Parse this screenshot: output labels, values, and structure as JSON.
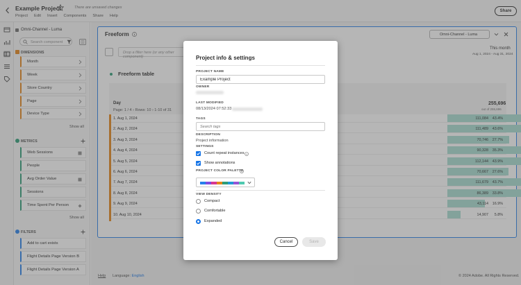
{
  "header": {
    "project_title": "Example Project",
    "unsaved_text": "There are unsaved changes",
    "menu": [
      "Project",
      "Edit",
      "Insert",
      "Components",
      "Share",
      "Help"
    ],
    "share_label": "Share"
  },
  "left_panel": {
    "report_suite": "Omni-Channel - Luma",
    "search_placeholder": "Search component",
    "dimensions_header": "DIMENSIONS",
    "dimensions": [
      "Month",
      "Week",
      "Store Country",
      "Page",
      "Device Type"
    ],
    "metrics_header": "METRICS",
    "metrics": [
      "Web Sessions",
      "People",
      "Avg Order Value",
      "Sessions",
      "Time Spent Per Person"
    ],
    "filters_header": "FILTERS",
    "filters": [
      "Add to cart exists",
      "Flight Details Page Version B",
      "Flight Details Page Version A"
    ],
    "show_all": "Show all"
  },
  "freeform": {
    "title": "Freeform",
    "suite_select": "Omni-Channel - Luma",
    "drop_filter_placeholder": "Drop a filter here (or any other component)",
    "date_label": "This month",
    "date_range": "Aug 1, 2024 - Aug 31, 2024",
    "table_title": "Freeform table",
    "day_header": "Day",
    "page_info": "Page: 1 / 4 › Rows: 10 › 1-10 of 31",
    "total_value": "255,696",
    "total_sub": "out of 255,696",
    "rows": [
      {
        "label": "1.  Aug 1, 2024",
        "value": "111,084",
        "pct": "43.4%",
        "share": 0.434
      },
      {
        "label": "2.  Aug 2, 2024",
        "value": "111,489",
        "pct": "43.6%",
        "share": 0.436
      },
      {
        "label": "3.  Aug 3, 2024",
        "value": "70,746",
        "pct": "27.7%",
        "share": 0.277
      },
      {
        "label": "4.  Aug 4, 2024",
        "value": "90,328",
        "pct": "35.3%",
        "share": 0.353
      },
      {
        "label": "5.  Aug 5, 2024",
        "value": "112,144",
        "pct": "43.9%",
        "share": 0.439
      },
      {
        "label": "6.  Aug 6, 2024",
        "value": "70,667",
        "pct": "27.6%",
        "share": 0.276
      },
      {
        "label": "7.  Aug 7, 2024",
        "value": "111,679",
        "pct": "43.7%",
        "share": 0.437
      },
      {
        "label": "8.  Aug 8, 2024",
        "value": "86,389",
        "pct": "33.8%",
        "share": 0.338
      },
      {
        "label": "9.  Aug 9, 2024",
        "value": "43,114",
        "pct": "16.9%",
        "share": 0.169
      },
      {
        "label": "10. Aug 10, 2024",
        "value": "14,907",
        "pct": "5.8%",
        "share": 0.058
      }
    ]
  },
  "footer": {
    "help": "Help",
    "language_label": "Language:",
    "language_value": "English",
    "copyright": "© 2024 Adobe. All Rights Reserved."
  },
  "modal": {
    "title": "Project info & settings",
    "project_name_label": "PROJECT NAME",
    "project_name_value": "Example Project",
    "owner_label": "OWNER",
    "last_modified_label": "LAST MODIFIED",
    "last_modified_value": "08/13/2024 07:52:33",
    "tags_label": "TAGS",
    "tags_placeholder": "Search tags",
    "description_label": "DESCRIPTION",
    "description_value": "Project information",
    "settings_label": "SETTINGS",
    "count_repeat_label": "Count repeat instances",
    "count_repeat_checked": true,
    "show_annotations_label": "Show annotations",
    "show_annotations_checked": true,
    "palette_label": "PROJECT COLOR PALETTE",
    "palette_colors": [
      "#2680eb",
      "#7e4ae0",
      "#d83790",
      "#e68619",
      "#2d9d78",
      "#1f9ad6",
      "#9456d6",
      "#4ec9b0"
    ],
    "view_density_label": "VIEW DENSITY",
    "density_options": [
      "Compact",
      "Comfortable",
      "Expanded"
    ],
    "density_selected": "Expanded",
    "cancel_label": "Cancel",
    "save_label": "Save"
  },
  "colors": {
    "accent": "#1473e6",
    "dimension": "#e68619",
    "metric": "#2d9d78",
    "filter": "#2680eb",
    "bar": "#a8dcd0"
  }
}
